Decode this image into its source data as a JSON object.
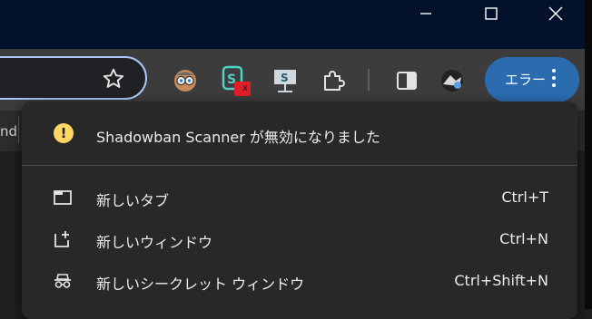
{
  "window": {
    "minimize_icon": "minimize-icon",
    "maximize_icon": "maximize-icon",
    "close_icon": "close-icon"
  },
  "toolbar": {
    "bookmark_icon": "star-icon",
    "extensions": [
      {
        "name": "face-extension-icon"
      },
      {
        "name": "shadowban-scanner-extension-icon",
        "badge": "x"
      },
      {
        "name": "s-extension-icon"
      },
      {
        "name": "puzzle-icon"
      },
      {
        "name": "side-panel-icon"
      },
      {
        "name": "profile-avatar"
      }
    ],
    "error_button": {
      "label": "エラー"
    }
  },
  "bookmarks_bar": {
    "partial_text": "nd"
  },
  "menu": {
    "notice": {
      "icon": "warning-icon",
      "text": "Shadowban Scanner が無効になりました"
    },
    "items": [
      {
        "icon": "new-tab-icon",
        "label": "新しいタブ",
        "shortcut": "Ctrl+T"
      },
      {
        "icon": "new-window-icon",
        "label": "新しいウィンドウ",
        "shortcut": "Ctrl+N"
      },
      {
        "icon": "incognito-icon",
        "label": "新しいシークレット ウィンドウ",
        "shortcut": "Ctrl+Shift+N"
      }
    ]
  },
  "colors": {
    "titlebar": "#03112a",
    "toolbar": "#3c3c3c",
    "menu_bg": "#282828",
    "accent": "#2b6cb0",
    "warning": "#fdd663",
    "omnibox_border": "#a8c7fa"
  }
}
